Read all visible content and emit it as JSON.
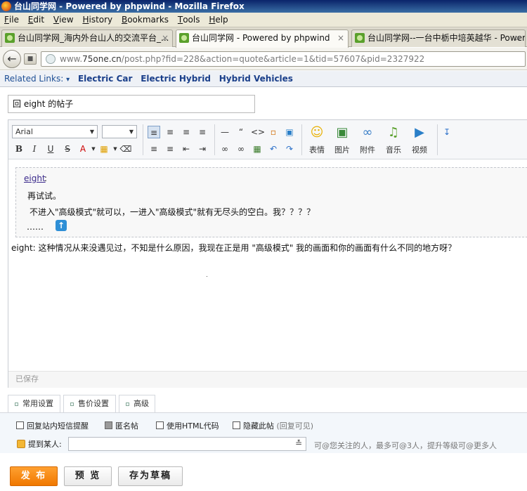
{
  "window": {
    "title": "台山同学网 - Powered by phpwind - Mozilla Firefox"
  },
  "menu": [
    {
      "label": "File",
      "key": "F",
      "rest": "ile"
    },
    {
      "label": "Edit",
      "key": "E",
      "rest": "dit"
    },
    {
      "label": "View",
      "key": "V",
      "rest": "iew"
    },
    {
      "label": "History",
      "key": "H",
      "rest": "istory"
    },
    {
      "label": "Bookmarks",
      "key": "B",
      "rest": "ookmarks"
    },
    {
      "label": "Tools",
      "key": "T",
      "rest": "ools"
    },
    {
      "label": "Help",
      "key": "H",
      "rest": "elp"
    }
  ],
  "tabs": [
    {
      "label": "台山同学网_海内外台山人的交流平台_...",
      "close": "×"
    },
    {
      "label": "台山同学网 - Powered by phpwind",
      "close": "×"
    },
    {
      "label": "台山同学网--一台中栃中培英越华 - Power...",
      "close": "×"
    }
  ],
  "nav": {
    "url_prefix": "www.",
    "url_host": "75one.cn",
    "url_path": "/post.php?fid=228&action=quote&article=1&tid=57607&pid=2327922"
  },
  "related": {
    "label": "Related Links:",
    "chevron": "▾",
    "links": [
      "Electric Car",
      "Electric Hybrid",
      "Hybrid Vehicles"
    ]
  },
  "post": {
    "subject": "回 eight 的帖子",
    "font": "Arial",
    "font_size": "",
    "toolbar_big": [
      {
        "label": "表情",
        "icon": "smiley-icon"
      },
      {
        "label": "图片",
        "icon": "image-icon"
      },
      {
        "label": "附件",
        "icon": "attachment-icon"
      },
      {
        "label": "音乐",
        "icon": "music-icon"
      },
      {
        "label": "视频",
        "icon": "video-icon"
      }
    ],
    "quote": {
      "author": "eight",
      "colon": ":",
      "line1": "再试试。",
      "line2": "不进入\"高级模式\"就可以，一进入\"高级模式\"就有无尽头的空白。我？？？？",
      "ellipsis": "……"
    },
    "reply": "eight: 这种情况从来没遇见过，不知是什么原因，我现在正是用 \"高级模式\" 我的画面和你的画面有什么不同的地方呀？",
    "saved_status": "已保存"
  },
  "settings": {
    "tabs": [
      "常用设置",
      "售价设置",
      "高级"
    ],
    "options": [
      {
        "label": "回复站内短信提醒",
        "checked": false
      },
      {
        "label": "匿名帖",
        "checked": false,
        "disabled": true
      },
      {
        "label": "使用HTML代码",
        "checked": false
      },
      {
        "label": "隐藏此帖",
        "hint": "(回复可见)",
        "checked": false
      }
    ],
    "mention_label": "提到某人:",
    "mention_hint": "可@您关注的人，最多可@3人，提升等级可@更多人"
  },
  "buttons": {
    "publish": "发 布",
    "preview": "预 览",
    "draft": "存为草稿"
  }
}
